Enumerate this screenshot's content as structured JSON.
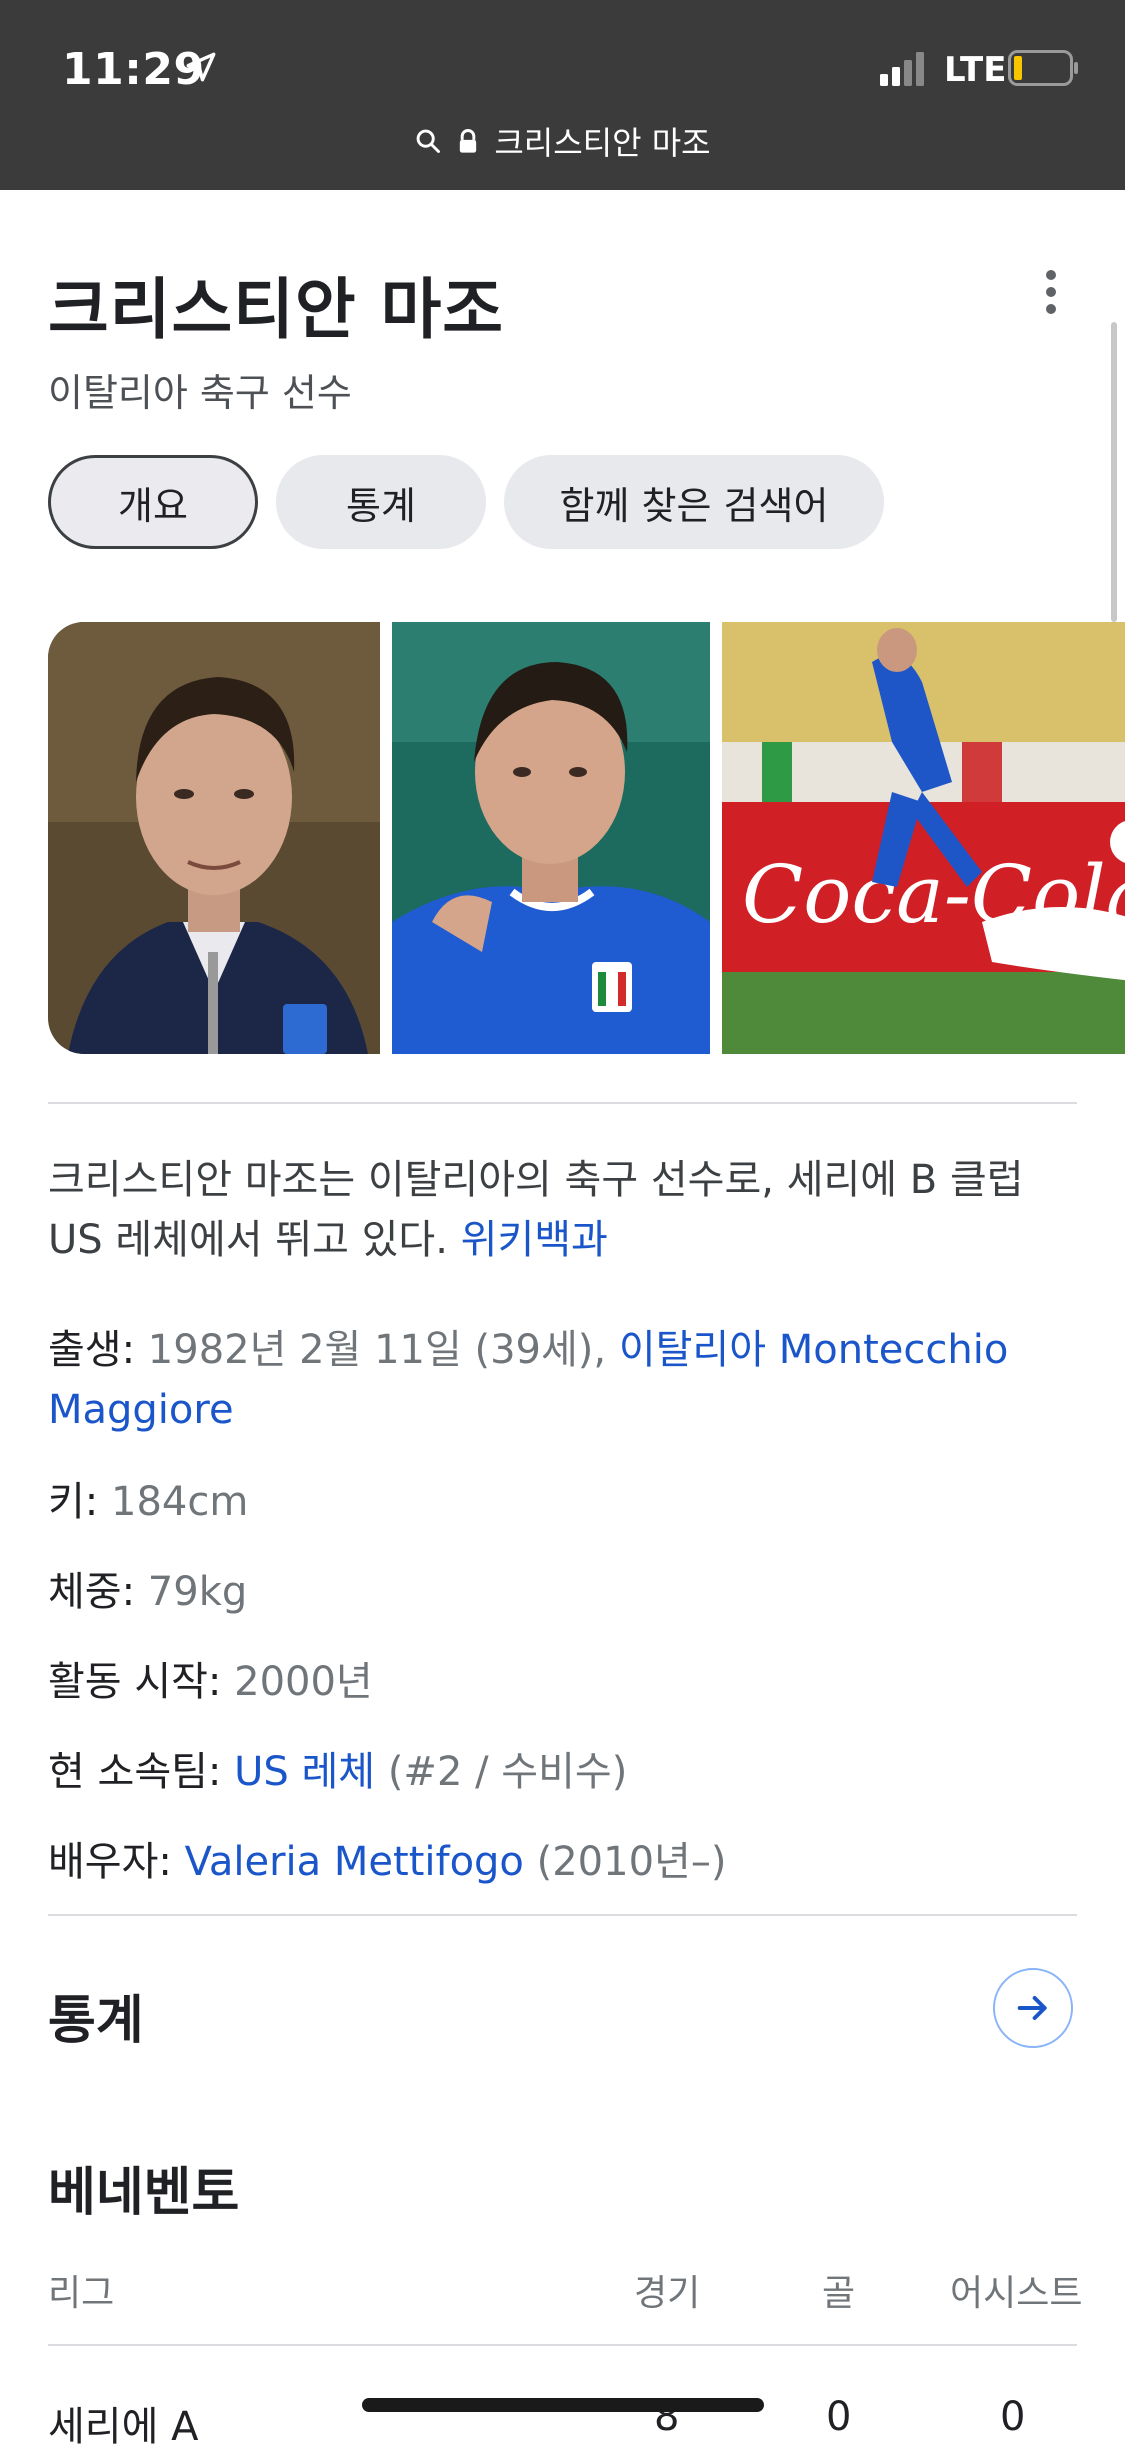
{
  "status_bar": {
    "time": "11:29",
    "network": "LTE"
  },
  "url_bar": {
    "text": "크리스티안 마조"
  },
  "entity": {
    "title": "크리스티안 마조",
    "subtitle": "이탈리아 축구 선수"
  },
  "chips": [
    {
      "label": "개요",
      "active": true
    },
    {
      "label": "통계",
      "active": false
    },
    {
      "label": "함께 찾은 검색어",
      "active": false
    }
  ],
  "description": {
    "text": "크리스티안 마조는 이탈리아의 축구 선수로, 세리에 B 클럽 US 레체에서 뛰고 있다. ",
    "source": "위키백과"
  },
  "facts": {
    "born": {
      "label": "출생:",
      "value": "1982년 2월 11일 (39세), ",
      "link": "이탈리아 Montecchio Maggiore"
    },
    "height": {
      "label": "키:",
      "value": "184cm"
    },
    "weight": {
      "label": "체중:",
      "value": "79kg"
    },
    "career_start": {
      "label": "활동 시작:",
      "value": "2000년"
    },
    "team": {
      "label": "현 소속팀:",
      "link": "US 레체",
      "value": " (#2 / 수비수)"
    },
    "spouse": {
      "label": "배우자:",
      "link": "Valeria Mettifogo",
      "value": " (2010년–)"
    }
  },
  "stats_section": {
    "title": "통계"
  },
  "team_section": {
    "title": "베네벤토",
    "columns": [
      "리그",
      "경기",
      "골",
      "어시스트"
    ],
    "rows": [
      {
        "league": "세리에 A",
        "games": "8",
        "goals": "0",
        "assists": "0"
      }
    ]
  },
  "colors": {
    "link": "#1a56c9",
    "topbar": "#3b3b3b",
    "chip": "#e8e9ed"
  }
}
